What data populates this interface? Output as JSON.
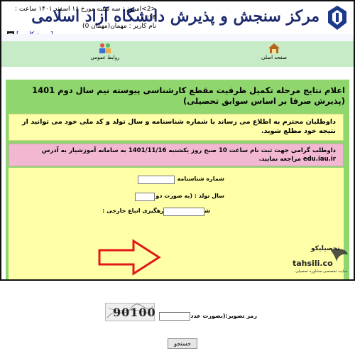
{
  "header": {
    "brand": "مرکز سنجش و پذیرش دانشگاه آزاد اسلامی",
    "datetime": "<2>امروز : سه شنبه مورخ ۱۶ اسفند ۱۴۰۱ ساعت : ۱۰:۴۴",
    "username": "نام کاربر : مهمان(مهمان 0)",
    "login_link": "[ ورود کاربر ]"
  },
  "menu": {
    "home": "صفحه اصلی",
    "public_relations": "روابط عمومی"
  },
  "notice": {
    "title": "اعلام نتایج مرحله تکمیل ظرفیت مقطع کارشناسی پیوسته نیم سال دوم 1401 (پذیرش صرفا بر اساس سوابق تحصیلی)",
    "info_yellow": "داوطلبان محترم به اطلاع می رساند با شماره شناسنامه و سال تولد و کد ملی خود می توانید از نتیجه خود مطلع شوید.",
    "info_pink": "داوطلب گرامی جهت ثبت نام ساعت 10 صبح روز یکشنبه 1401/11/16 به سامانه آموزشیار به آدرس edu.iau.ir مراجعه نمایید."
  },
  "form": {
    "id_number_label": "شماره شناسنامه :",
    "birth_year_label": "سال تولد : (به صورت دو رقم)",
    "national_code_label": "شماره ملی / کد رهگیری اتباع خارجی :",
    "captcha_text": "90100",
    "captcha_label": "رمز تصویر:(بصورت عددی)",
    "submit_label": "جستجو"
  },
  "watermark": {
    "name_fa": "تحصیلیکو",
    "domain": "tahsili.co",
    "tagline": "سایت تخصصی مشاوره تحصیلی"
  },
  "colors": {
    "menu_bg": "#c6ebc6",
    "notice_bg": "#8fd66e",
    "yellow_box": "#ffffaa",
    "pink_box": "#f2b8d2",
    "arrow": "#e01818"
  }
}
